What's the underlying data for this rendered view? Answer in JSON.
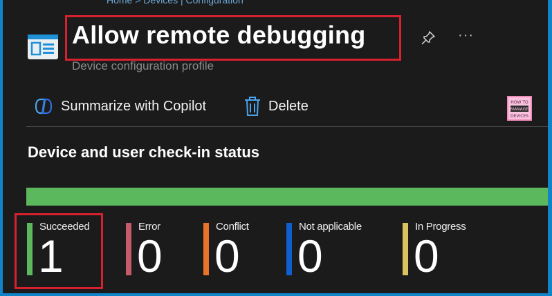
{
  "header": {
    "breadcrumb": "Home > Devices | Configuration",
    "title": "Allow remote debugging",
    "subtitle": "Device configuration profile"
  },
  "toolbar": {
    "copilot_label": "Summarize with Copilot",
    "delete_label": "Delete"
  },
  "status": {
    "heading": "Device and user check-in status",
    "bar_color": "#5cb85c",
    "items": [
      {
        "label": "Succeeded",
        "value": "1",
        "color": "#5cb85c"
      },
      {
        "label": "Error",
        "value": "0",
        "color": "#c55b6a"
      },
      {
        "label": "Conflict",
        "value": "0",
        "color": "#e8742c"
      },
      {
        "label": "Not applicable",
        "value": "0",
        "color": "#0f5fd0"
      },
      {
        "label": "In Progress",
        "value": "0",
        "color": "#dcc25e"
      }
    ]
  },
  "icons": {
    "profile": "profile-icon",
    "pin": "pin-icon",
    "more": "more-icon",
    "copilot": "copilot-icon",
    "delete": "trash-icon",
    "logo": "how-to-manage-devices-logo"
  },
  "logo_text": [
    "HOW TO",
    "MANAGE",
    "DEVICES"
  ],
  "accent_colors": {
    "highlight": "#d7212e",
    "background": "#1b1b1b",
    "outer": "#0f84c9"
  }
}
